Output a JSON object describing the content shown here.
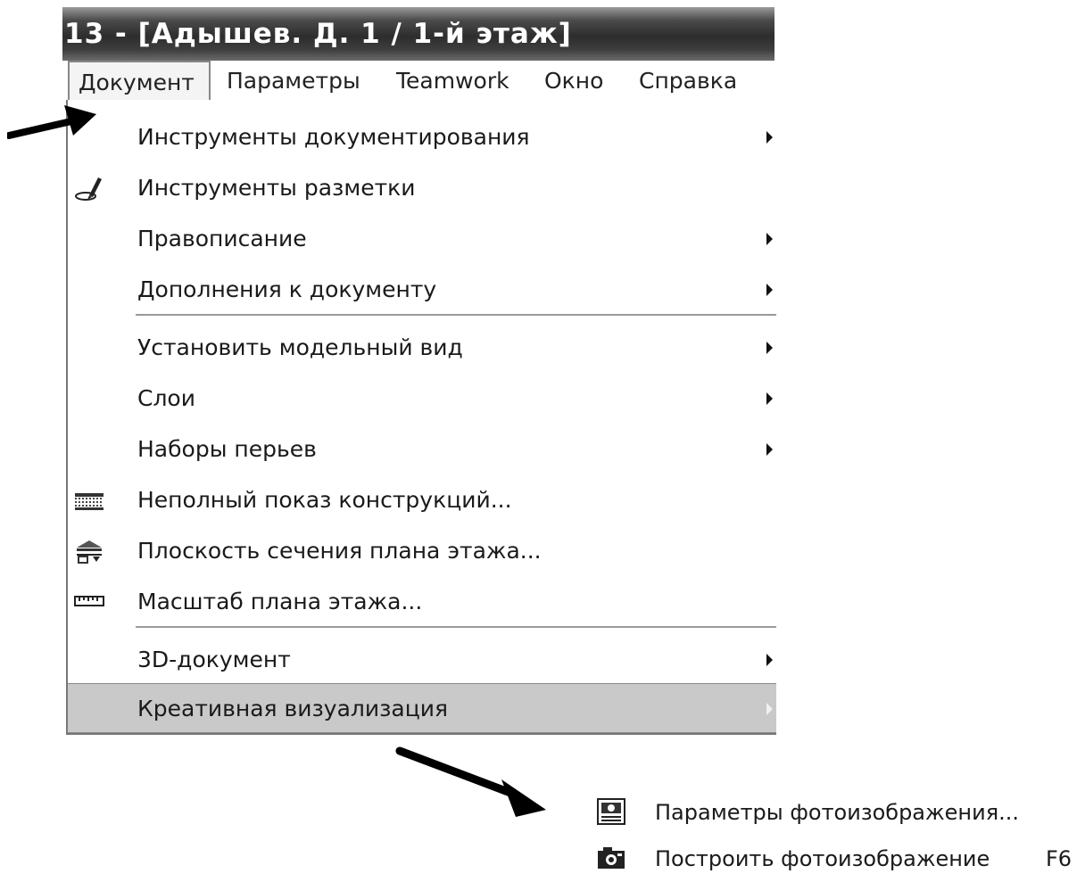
{
  "window": {
    "title": "13 - [Адышев. Д. 1 / 1-й этаж]"
  },
  "menubar": {
    "items": [
      "Документ",
      "Параметры",
      "Teamwork",
      "Окно",
      "Справка"
    ]
  },
  "menu": {
    "items": [
      {
        "label": "Инструменты документирования",
        "submenu": true
      },
      {
        "label": "Инструменты разметки",
        "icon": "markup-pen-icon"
      },
      {
        "label": "Правописание",
        "submenu": true
      },
      {
        "label": "Дополнения к документу",
        "submenu": true
      },
      {
        "label": "Установить модельный вид",
        "submenu": true
      },
      {
        "label": "Слои",
        "submenu": true
      },
      {
        "label": "Наборы перьев",
        "submenu": true
      },
      {
        "label": "Неполный показ конструкций...",
        "icon": "partial-structure-icon"
      },
      {
        "label": "Плоскость сечения плана этажа...",
        "icon": "cut-plane-icon"
      },
      {
        "label": "Масштаб плана этажа...",
        "icon": "scale-ruler-icon"
      },
      {
        "label": "3D-документ",
        "submenu": true
      },
      {
        "label": "Креативная визуализация",
        "submenu": true,
        "highlighted": true
      }
    ]
  },
  "submenu": {
    "items": [
      {
        "label": "Параметры фотоизображения...",
        "icon": "photo-settings-icon"
      },
      {
        "label": "Построить фотоизображение",
        "shortcut": "F6",
        "icon": "camera-icon"
      }
    ]
  }
}
